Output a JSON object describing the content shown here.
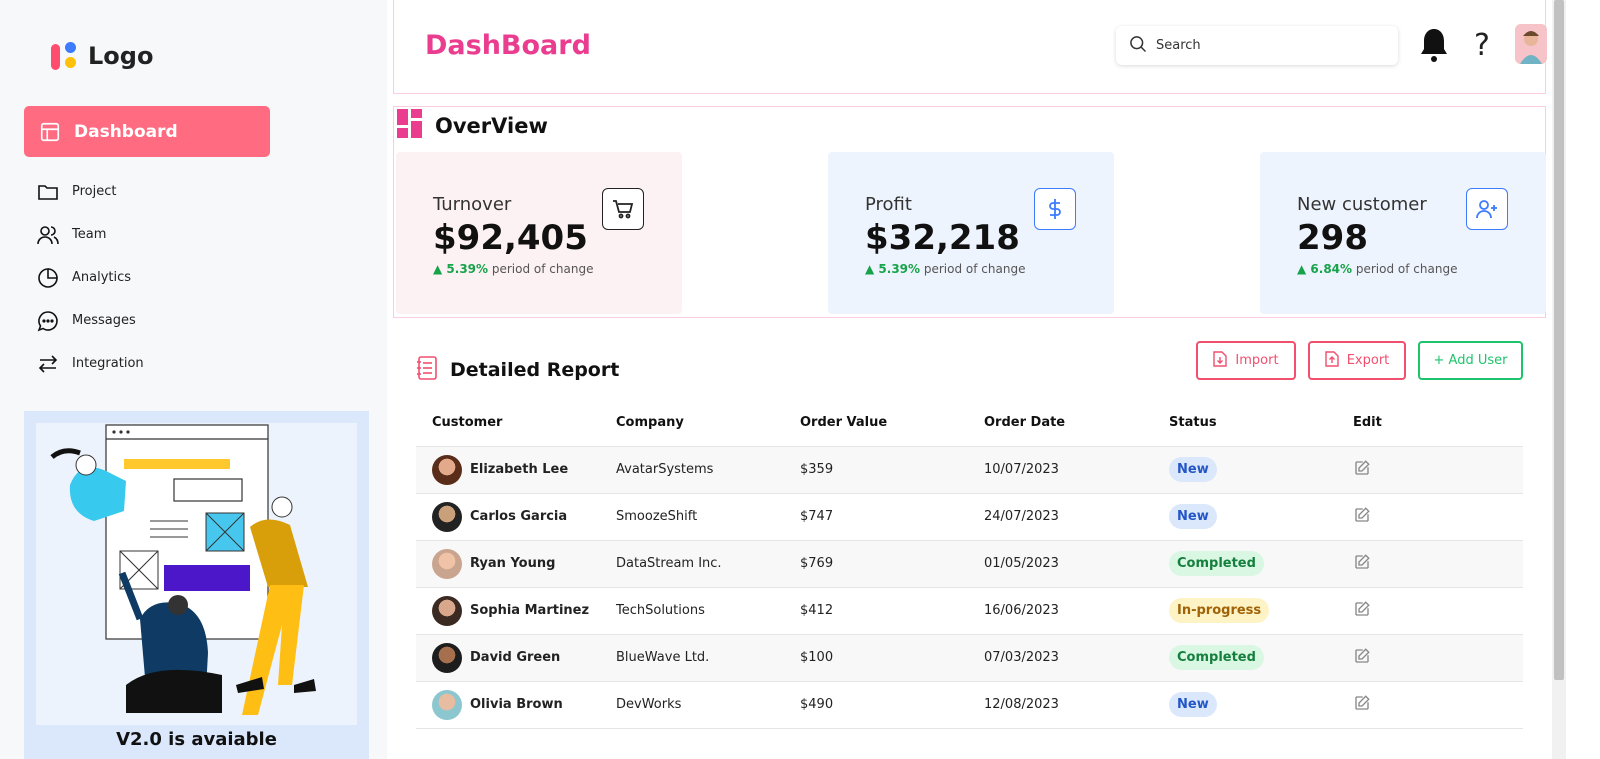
{
  "sidebar": {
    "logo_text": "Logo",
    "active_item": {
      "label": "Dashboard",
      "icon": "dashboard-icon"
    },
    "items": [
      {
        "label": "Project",
        "icon": "folder-icon"
      },
      {
        "label": "Team",
        "icon": "team-icon"
      },
      {
        "label": "Analytics",
        "icon": "pie-chart-icon"
      },
      {
        "label": "Messages",
        "icon": "chat-icon"
      },
      {
        "label": "Integration",
        "icon": "arrows-icon"
      }
    ],
    "promo_text": "V2.0 is avaiable"
  },
  "header": {
    "title": "DashBoard",
    "search_placeholder": "Search",
    "help_glyph": "?"
  },
  "overview": {
    "title": "OverView",
    "cards": [
      {
        "label": "Turnover",
        "value": "$92,405",
        "pct": "5.39%",
        "suffix": " period of change",
        "icon": "cart-icon",
        "bg": "#fdf2f3",
        "icon_color": "#222222"
      },
      {
        "label": "Profit",
        "value": "$32,218",
        "pct": "5.39%",
        "suffix": " period of change",
        "icon": "dollar-icon",
        "bg": "#eef4fd",
        "icon_color": "#3d7bff"
      },
      {
        "label": "New customer",
        "value": "298",
        "pct": "6.84%",
        "suffix": " period of change",
        "icon": "add-user-icon",
        "bg": "#eef4fd",
        "icon_color": "#3d7bff"
      }
    ]
  },
  "report": {
    "title": "Detailed Report",
    "import_label": "Import",
    "export_label": "Export",
    "add_user_label": "+ Add User",
    "columns": [
      "Customer",
      "Company",
      "Order Value",
      "Order Date",
      "Status",
      "Edit"
    ],
    "rows": [
      {
        "customer": "Elizabeth Lee",
        "company": "AvatarSystems",
        "value": "$359",
        "date": "10/07/2023",
        "status": "New"
      },
      {
        "customer": "Carlos Garcia",
        "company": "SmoozeShift",
        "value": "$747",
        "date": "24/07/2023",
        "status": "New"
      },
      {
        "customer": "Ryan Young",
        "company": "DataStream Inc.",
        "value": "$769",
        "date": "01/05/2023",
        "status": "Completed"
      },
      {
        "customer": "Sophia Martinez",
        "company": "TechSolutions",
        "value": "$412",
        "date": "16/06/2023",
        "status": "In-progress"
      },
      {
        "customer": "David Green",
        "company": "BlueWave Ltd.",
        "value": "$100",
        "date": "07/03/2023",
        "status": "Completed"
      },
      {
        "customer": "Olivia Brown",
        "company": "DevWorks",
        "value": "$490",
        "date": "12/08/2023",
        "status": "New"
      }
    ]
  },
  "colors": {
    "accent_pink": "#ea3d8f",
    "nav_active": "#ff6b81",
    "positive": "#18a34a",
    "danger": "#f0506e",
    "success": "#1ec46b"
  }
}
